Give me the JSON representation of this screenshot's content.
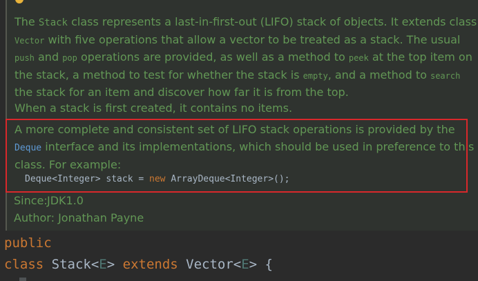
{
  "javadoc": {
    "paragraph1": {
      "l1a": "The ",
      "l1b": "Stack",
      "l1c": " class represents a last-in-first-out (LIFO) stack of objects. It extends class",
      "l2a": "Vector",
      "l2b": " with five operations that allow a vector to be treated as a stack. The usual",
      "l3a": "push",
      "l3b": " and ",
      "l3c": "pop",
      "l3d": " operations are provided, as well as a method to ",
      "l3e": "peek",
      "l3f": " at the top item on",
      "l4a": "the stack, a method to test for whether the stack is ",
      "l4b": "empty",
      "l4c": ", and a method to ",
      "l4d": "search",
      "l5": "the stack for an item and discover how far it is from the top."
    },
    "paragraph2": "When a stack is first created, it contains no items.",
    "paragraph3": {
      "l1": "A more complete and consistent set of LIFO stack operations is provided by the",
      "l2a": "Deque",
      "l2b": " interface and its implementations, which should be used in preference to this",
      "l3": "class. For example:"
    },
    "example": {
      "part1": "Deque<Integer> stack = ",
      "kw_new": "new",
      "part2": " ArrayDeque<Integer>();"
    },
    "since": {
      "label": "Since:",
      "value": "JDK1.0"
    },
    "author": {
      "label": "Author:",
      "value": "Jonathan Payne"
    }
  },
  "code": {
    "kw_public": "public",
    "kw_class": "class",
    "class_name": " Stack<",
    "type_param1": "E",
    "gt1": "> ",
    "kw_extends": "extends",
    "super_name": " Vector<",
    "type_param2": "E",
    "rest": "> {"
  },
  "colors": {
    "background": "#2b2b2b",
    "doc_text": "#629755",
    "link": "#5f9bd6",
    "keyword": "#cc7832",
    "highlight_border": "#d9282b"
  },
  "icons": {
    "intention": "lightbulb-icon"
  }
}
